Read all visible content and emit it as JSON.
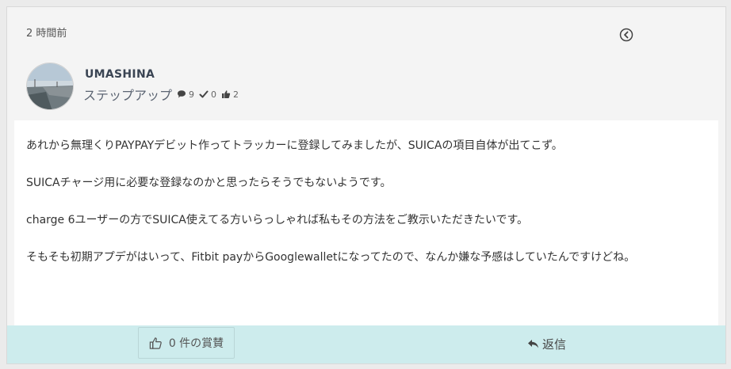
{
  "post": {
    "timestamp": "2 時間前",
    "author": {
      "name": "UMASHINA",
      "rank": "ステップアップ",
      "stats": {
        "posts": "9",
        "solutions": "0",
        "kudos": "2"
      }
    },
    "paragraphs": [
      "あれから無理くりPAYPAYデビット作ってトラッカーに登録してみましたが、SUICAの項目自体が出てこず。",
      "SUICAチャージ用に必要な登録なのかと思ったらそうでもないようです。",
      "charge 6ユーザーの方でSUICA使えてる方いらっしゃれば私もその方法をご教示いただきたいです。",
      "そもそも初期アプデがはいって、Fitbit payからGooglewalletになってたので、なんか嫌な予感はしていたんですけどね。"
    ]
  },
  "footer": {
    "kudos_label": "0 件の賞賛",
    "reply_label": "返信"
  },
  "icons": {
    "back": "circle-chevron-left-icon",
    "comment": "speech-bubble-icon",
    "check": "checkmark-icon",
    "thumbs_up": "thumbs-up-icon",
    "reply": "reply-arrow-icon"
  },
  "colors": {
    "footer_bg": "#cdeced",
    "card_bg": "#f4f4f4",
    "body_bg": "#ffffff",
    "username": "#3a4453"
  }
}
